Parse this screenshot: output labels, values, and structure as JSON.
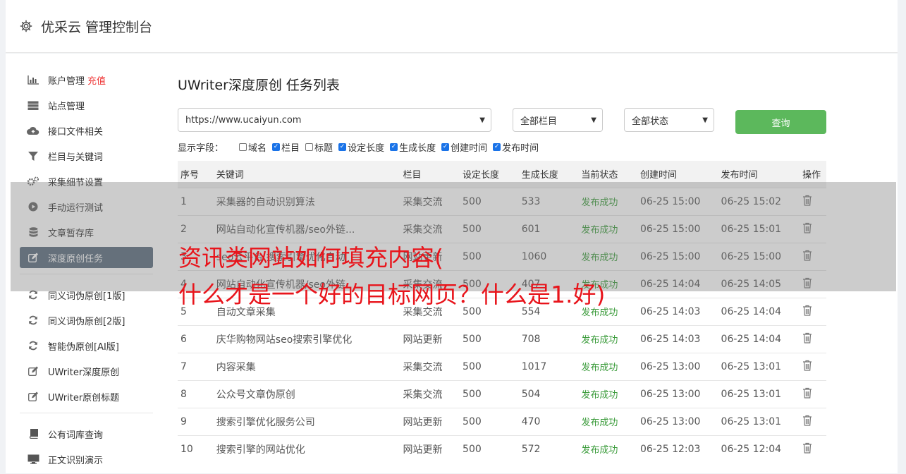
{
  "app": {
    "title": "优采云 管理控制台"
  },
  "sidebar": {
    "items": [
      {
        "label": "账户管理",
        "badge": "充值",
        "icon": "bar-chart-icon"
      },
      {
        "label": "站点管理",
        "icon": "server-icon"
      },
      {
        "label": "接口文件相关",
        "icon": "cloud-upload-icon"
      },
      {
        "label": "栏目与关键词",
        "icon": "filter-icon"
      },
      {
        "label": "采集细节设置",
        "icon": "gears-icon"
      },
      {
        "label": "手动运行测试",
        "icon": "play-circle-icon"
      },
      {
        "label": "文章暂存库",
        "icon": "database-icon"
      },
      {
        "label": "深度原创任务",
        "icon": "edit-icon",
        "active": true
      },
      {
        "label": "同义词伪原创[1版]",
        "icon": "refresh-icon"
      },
      {
        "label": "同义词伪原创[2版]",
        "icon": "refresh-icon"
      },
      {
        "label": "智能伪原创[AI版]",
        "icon": "refresh-icon"
      },
      {
        "label": "UWriter深度原创",
        "icon": "edit-icon"
      },
      {
        "label": "UWriter原创标题",
        "icon": "edit-icon"
      },
      {
        "label": "公有词库查询",
        "icon": "book-icon"
      },
      {
        "label": "正文识别演示",
        "icon": "monitor-icon"
      }
    ]
  },
  "main": {
    "title": "UWriter深度原创 任务列表",
    "site_select": "https://www.ucaiyun.com",
    "column_select": "全部栏目",
    "status_select": "全部状态",
    "query_label": "查询",
    "fields_label": "显示字段：",
    "fields": [
      {
        "label": "域名",
        "checked": false
      },
      {
        "label": "栏目",
        "checked": true
      },
      {
        "label": "标题",
        "checked": false
      },
      {
        "label": "设定长度",
        "checked": true
      },
      {
        "label": "生成长度",
        "checked": true
      },
      {
        "label": "创建时间",
        "checked": true
      },
      {
        "label": "发布时间",
        "checked": true
      }
    ]
  },
  "table": {
    "headers": [
      "序号",
      "关键词",
      "栏目",
      "设定长度",
      "生成长度",
      "当前状态",
      "创建时间",
      "发布时间",
      "操作"
    ],
    "rows": [
      [
        "1",
        "采集器的自动识别算法",
        "采集交流",
        "500",
        "533",
        "发布成功",
        "06-25 15:00",
        "06-25 15:02"
      ],
      [
        "2",
        "网站自动化宣传机器/seo外链...",
        "采集交流",
        "500",
        "601",
        "发布成功",
        "06-25 15:00",
        "06-25 15:01"
      ],
      [
        "3",
        "seo云平台 搜索引擎优化自动",
        "网站更新",
        "500",
        "1060",
        "发布成功",
        "06-25 15:00",
        "06-25 15:00"
      ],
      [
        "4",
        "网站自动化宣传机器/seo外链",
        "采集交流",
        "500",
        "407",
        "发布成功",
        "06-25 14:04",
        "06-25 14:05"
      ],
      [
        "5",
        "自动文章采集",
        "采集交流",
        "500",
        "554",
        "发布成功",
        "06-25 14:03",
        "06-25 14:04"
      ],
      [
        "6",
        "庆华购物网站seo搜索引擎优化",
        "网站更新",
        "500",
        "708",
        "发布成功",
        "06-25 14:03",
        "06-25 14:04"
      ],
      [
        "7",
        "内容采集",
        "采集交流",
        "500",
        "1017",
        "发布成功",
        "06-25 13:00",
        "06-25 13:01"
      ],
      [
        "8",
        "公众号文章伪原创",
        "采集交流",
        "500",
        "504",
        "发布成功",
        "06-25 13:00",
        "06-25 13:01"
      ],
      [
        "9",
        "搜索引擎优化服务公司",
        "网站更新",
        "500",
        "470",
        "发布成功",
        "06-25 13:00",
        "06-25 13:01"
      ],
      [
        "10",
        "搜索引擎的网站优化",
        "网站更新",
        "500",
        "572",
        "发布成功",
        "06-25 12:03",
        "06-25 12:04"
      ]
    ]
  },
  "overlay": {
    "line1": "资讯类网站如何填充内容(",
    "line2": "什么才是一个好的目标网页？什么是1.好)"
  },
  "colors": {
    "status_ok": "#3a9b3a",
    "query_button": "#5cb85c",
    "active_nav": "#5a6b7d",
    "headline": "#e8141b"
  }
}
